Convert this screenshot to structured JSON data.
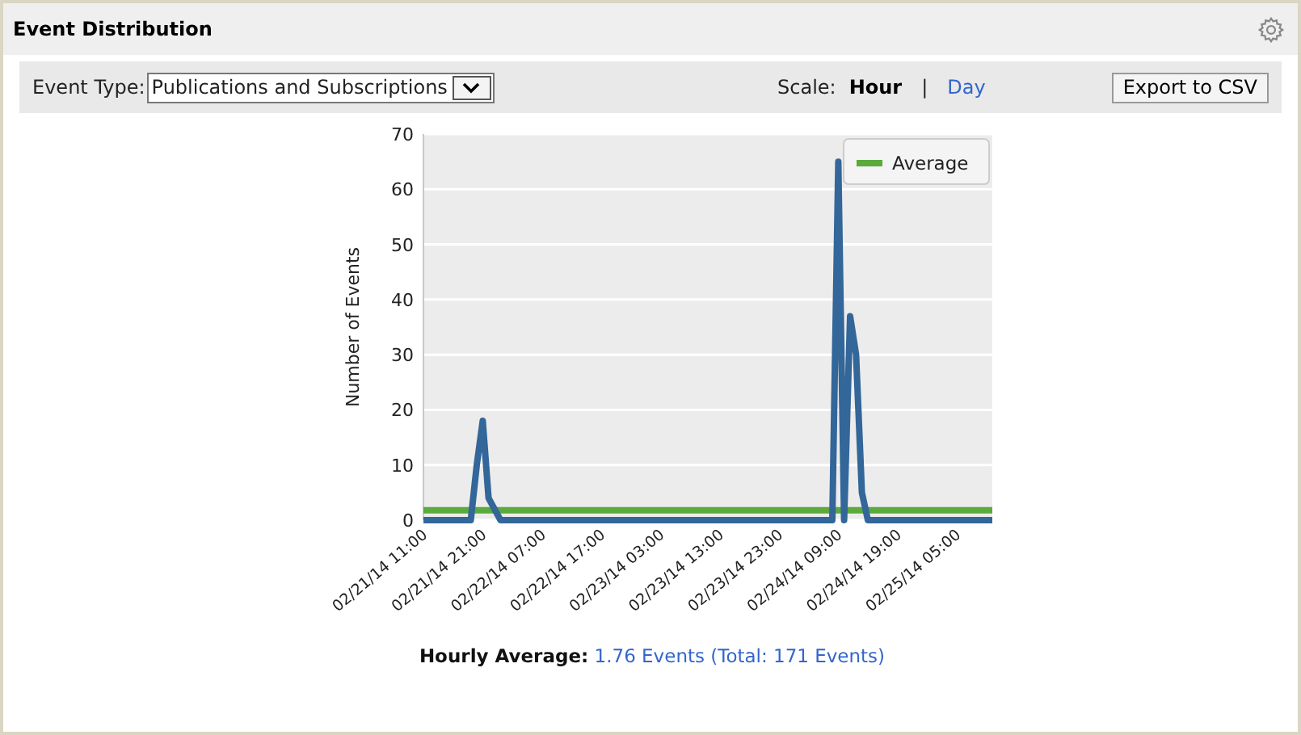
{
  "panel": {
    "title": "Event Distribution"
  },
  "toolbar": {
    "event_type_label": "Event Type:",
    "event_type_value": "Publications and Subscriptions",
    "scale_label": "Scale:",
    "separator": "|",
    "export_button": "Export to CSV",
    "scales": [
      {
        "label": "Hour",
        "selected": true
      },
      {
        "label": "Day",
        "selected": false
      }
    ]
  },
  "chart_data": {
    "type": "line",
    "ylabel": "Number of Events",
    "grid": true,
    "categories": [
      "02/21/14 11:00",
      null,
      null,
      null,
      null,
      null,
      null,
      null,
      null,
      null,
      "02/21/14 21:00",
      null,
      null,
      null,
      null,
      null,
      null,
      null,
      null,
      null,
      "02/22/14 07:00",
      null,
      null,
      null,
      null,
      null,
      null,
      null,
      null,
      null,
      "02/22/14 17:00",
      null,
      null,
      null,
      null,
      null,
      null,
      null,
      null,
      null,
      "02/23/14 03:00",
      null,
      null,
      null,
      null,
      null,
      null,
      null,
      null,
      null,
      "02/23/14 13:00",
      null,
      null,
      null,
      null,
      null,
      null,
      null,
      null,
      null,
      "02/23/14 23:00",
      null,
      null,
      null,
      null,
      null,
      null,
      null,
      null,
      null,
      "02/24/14 09:00",
      null,
      null,
      null,
      null,
      null,
      null,
      null,
      null,
      null,
      "02/24/14 19:00",
      null,
      null,
      null,
      null,
      null,
      null,
      null,
      null,
      null,
      "02/25/14 05:00",
      null,
      null,
      null,
      null,
      null,
      null
    ],
    "ylim": [
      0,
      70
    ],
    "yticks": [
      0,
      10,
      20,
      30,
      40,
      50,
      60,
      70
    ],
    "series": [
      {
        "color": "#336699",
        "values": [
          0,
          0,
          0,
          0,
          0,
          0,
          0,
          0,
          0,
          10,
          18,
          4,
          2,
          0,
          0,
          0,
          0,
          0,
          0,
          0,
          0,
          0,
          0,
          0,
          0,
          0,
          0,
          0,
          0,
          0,
          0,
          0,
          0,
          0,
          0,
          0,
          0,
          0,
          0,
          0,
          0,
          0,
          0,
          0,
          0,
          0,
          0,
          0,
          0,
          0,
          0,
          0,
          0,
          0,
          0,
          0,
          0,
          0,
          0,
          0,
          0,
          0,
          0,
          0,
          0,
          0,
          0,
          0,
          0,
          0,
          65,
          0,
          37,
          30,
          5,
          0,
          0,
          0,
          0,
          0,
          0,
          0,
          0,
          0,
          0,
          0,
          0,
          0,
          0,
          0,
          0,
          0,
          0,
          0,
          0,
          0,
          0
        ]
      },
      {
        "name": "Average",
        "color": "#5aaa3c",
        "values": [
          1.8,
          1.8,
          1.8,
          1.8,
          1.8,
          1.8,
          1.8,
          1.8,
          1.8,
          1.8,
          1.8,
          1.8,
          1.8,
          1.8,
          1.8,
          1.8,
          1.8,
          1.8,
          1.8,
          1.8,
          1.8,
          1.8,
          1.8,
          1.8,
          1.8,
          1.8,
          1.8,
          1.8,
          1.8,
          1.8,
          1.8,
          1.8,
          1.8,
          1.8,
          1.8,
          1.8,
          1.8,
          1.8,
          1.8,
          1.8,
          1.8,
          1.8,
          1.8,
          1.8,
          1.8,
          1.8,
          1.8,
          1.8,
          1.8,
          1.8,
          1.8,
          1.8,
          1.8,
          1.8,
          1.8,
          1.8,
          1.8,
          1.8,
          1.8,
          1.8,
          1.8,
          1.8,
          1.8,
          1.8,
          1.8,
          1.8,
          1.8,
          1.8,
          1.8,
          1.8,
          1.8,
          1.8,
          1.8,
          1.8,
          1.8,
          1.8,
          1.8,
          1.8,
          1.8,
          1.8,
          1.8,
          1.8,
          1.8,
          1.8,
          1.8,
          1.8,
          1.8,
          1.8,
          1.8,
          1.8,
          1.8,
          1.8,
          1.8,
          1.8,
          1.8,
          1.8,
          1.8
        ]
      }
    ]
  },
  "summary": {
    "label": "Hourly Average:",
    "value": "1.76 Events (Total: 171 Events)"
  }
}
